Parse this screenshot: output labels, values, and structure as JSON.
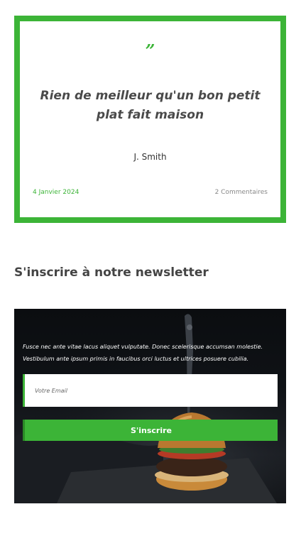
{
  "testimonial": {
    "quote_mark": "”",
    "text": "Rien de meilleur qu'un bon petit plat fait maison",
    "author": "J. Smith",
    "date": "4 Janvier 2024",
    "comments": "2 Commentaires"
  },
  "newsletter": {
    "title": "S'inscrire à notre newsletter",
    "description": "Fusce nec ante vitae lacus aliquet vulputate. Donec scelerisque accumsan molestie. Vestibulum ante ipsum primis in faucibus orci luctus et ultrices posuere cubilia.",
    "email_placeholder": "Votre Email",
    "submit_label": "S'inscrire"
  },
  "colors": {
    "accent": "#3cb437",
    "panel_bg": "#0f1216",
    "text_dark": "#4a4a4a"
  }
}
